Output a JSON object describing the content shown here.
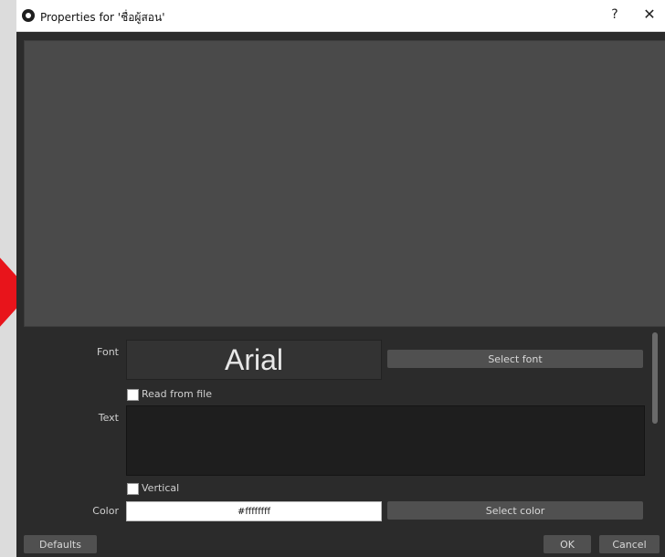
{
  "window": {
    "title": "Properties for 'ชื่อผู้สอน'",
    "help_label": "?",
    "close_label": "✕"
  },
  "form": {
    "font_label": "Font",
    "font_preview": "Arial",
    "select_font_label": "Select font",
    "read_from_file_label": "Read from file",
    "text_label": "Text",
    "vertical_label": "Vertical",
    "color_label": "Color",
    "color_value": "#ffffffff",
    "select_color_label": "Select color"
  },
  "footer": {
    "defaults_label": "Defaults",
    "ok_label": "OK",
    "cancel_label": "Cancel"
  },
  "colors": {
    "accent_arrow": "#e8141b",
    "panel_bg": "#2b2b2b",
    "preview_bg": "#4a4a4a"
  }
}
